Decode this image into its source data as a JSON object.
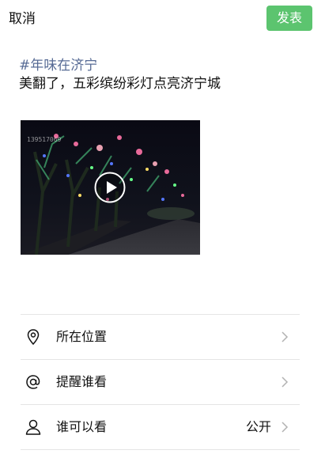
{
  "header": {
    "cancel_label": "取消",
    "publish_label": "发表"
  },
  "post": {
    "hashtag": "#年味在济宁",
    "caption": "美翻了，五彩缤纷彩灯点亮济宁城"
  },
  "video": {
    "watermark": "139517069",
    "play_icon": "play-icon"
  },
  "menu": {
    "items": [
      {
        "icon": "location-icon",
        "label": "所在位置",
        "value": ""
      },
      {
        "icon": "at-icon",
        "label": "提醒谁看",
        "value": ""
      },
      {
        "icon": "person-icon",
        "label": "谁可以看",
        "value": "公开"
      }
    ]
  },
  "colors": {
    "publish_bg": "#5cc46f",
    "hashtag": "#576b95",
    "divider": "#e5e5e5"
  }
}
